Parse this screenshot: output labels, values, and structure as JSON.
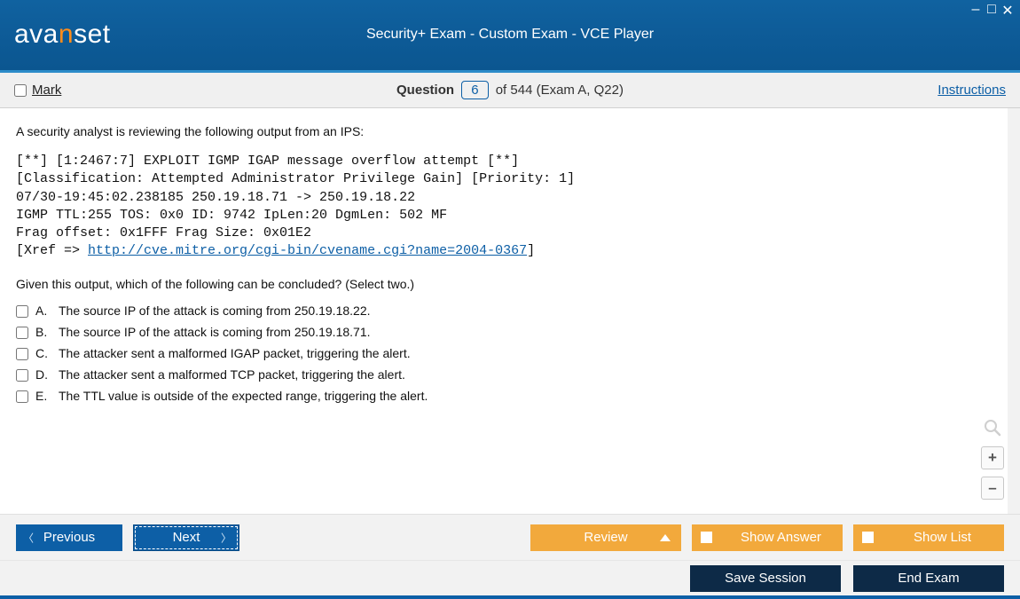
{
  "window": {
    "brand_a": "ava",
    "brand_n": "n",
    "brand_b": "set",
    "title": "Security+ Exam - Custom Exam - VCE Player"
  },
  "infobar": {
    "mark_label": "Mark",
    "question_word": "Question",
    "current_number": "6",
    "of_text": "of 544 (Exam A, Q22)",
    "instructions": "Instructions"
  },
  "question": {
    "prompt": "A security analyst is reviewing the following output from an IPS:",
    "log_line1": "[**] [1:2467:7] EXPLOIT IGMP IGAP message overflow attempt [**]",
    "log_line2": "[Classification: Attempted Administrator Privilege Gain] [Priority: 1]",
    "log_line3": "07/30-19:45:02.238185 250.19.18.71 -> 250.19.18.22",
    "log_line4": "IGMP TTL:255 TOS: 0x0 ID: 9742 IpLen:20 DgmLen: 502 MF",
    "log_line5": "Frag offset: 0x1FFF Frag Size: 0x01E2",
    "log_xref_pre": "[Xref => ",
    "log_xref_link": "http://cve.mitre.org/cgi-bin/cvename.cgi?name=2004-0367",
    "log_xref_post": "]",
    "sub_prompt": "Given this output, which of the following can be concluded? (Select two.)",
    "answers": [
      {
        "letter": "A.",
        "text": "The source IP of the attack is coming from 250.19.18.22."
      },
      {
        "letter": "B.",
        "text": "The source IP of the attack is coming from 250.19.18.71."
      },
      {
        "letter": "C.",
        "text": "The attacker sent a malformed IGAP packet, triggering the alert."
      },
      {
        "letter": "D.",
        "text": "The attacker sent a malformed TCP packet, triggering the alert."
      },
      {
        "letter": "E.",
        "text": "The TTL value is outside of the expected range, triggering the alert."
      }
    ]
  },
  "nav": {
    "previous": "Previous",
    "next": "Next",
    "review": "Review",
    "show_answer": "Show Answer",
    "show_list": "Show List"
  },
  "bottom": {
    "save_session": "Save Session",
    "end_exam": "End Exam"
  }
}
